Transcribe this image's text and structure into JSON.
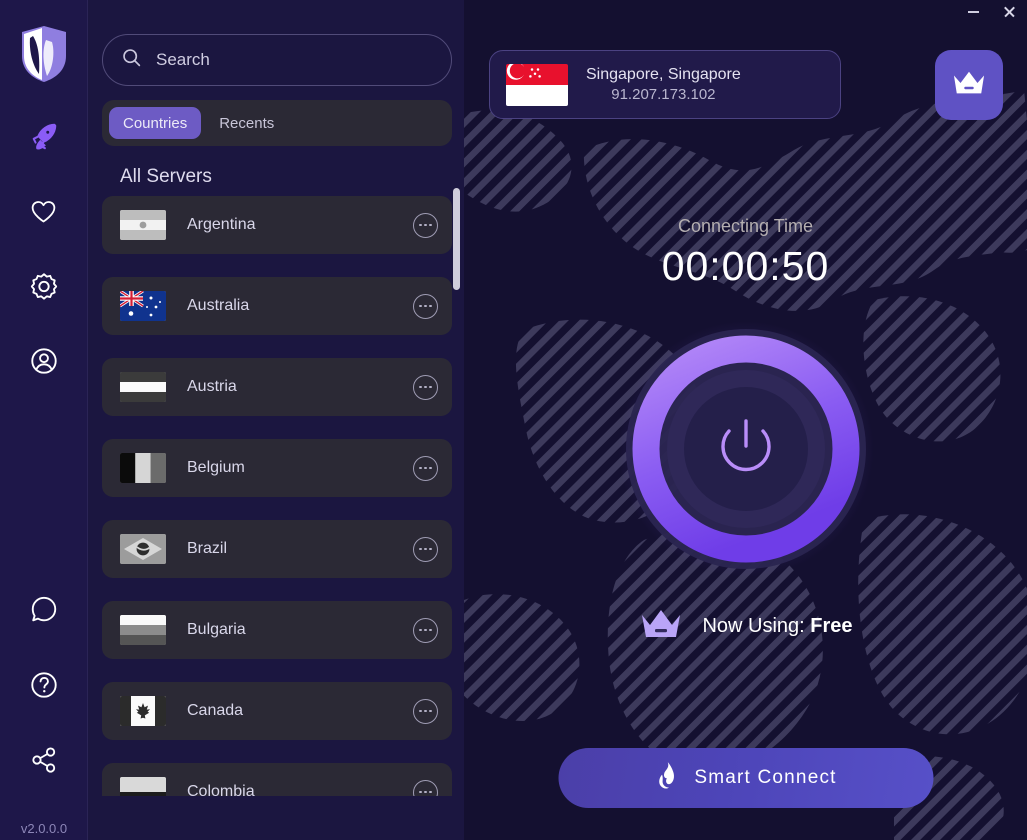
{
  "window": {
    "minimize_label": "Minimize",
    "close_label": "Close"
  },
  "sidebar": {
    "logo_name": "shield-logo",
    "version": "v2.0.0.0",
    "top_items": [
      {
        "name": "rocket",
        "label": "Connect",
        "active": true
      },
      {
        "name": "heart",
        "label": "Favorites",
        "active": false
      },
      {
        "name": "gear",
        "label": "Settings",
        "active": false
      },
      {
        "name": "user",
        "label": "Account",
        "active": false
      }
    ],
    "bottom_items": [
      {
        "name": "chat",
        "label": "Chat Support"
      },
      {
        "name": "help",
        "label": "Help"
      },
      {
        "name": "share",
        "label": "Share"
      }
    ]
  },
  "search": {
    "value": "",
    "placeholder": "Search",
    "icon": "search-icon"
  },
  "tabs": [
    {
      "label": "Countries",
      "active": true
    },
    {
      "label": "Recents",
      "active": false
    }
  ],
  "server_list": {
    "title": "All Servers",
    "more_icon": "ellipsis-icon",
    "countries": [
      {
        "name": "Argentina",
        "flag": "ar"
      },
      {
        "name": "Australia",
        "flag": "au"
      },
      {
        "name": "Austria",
        "flag": "at"
      },
      {
        "name": "Belgium",
        "flag": "be"
      },
      {
        "name": "Brazil",
        "flag": "br"
      },
      {
        "name": "Bulgaria",
        "flag": "bg"
      },
      {
        "name": "Canada",
        "flag": "ca"
      },
      {
        "name": "Colombia",
        "flag": "co"
      }
    ]
  },
  "connection": {
    "location": "Singapore, Singapore",
    "ip": "91.207.173.102",
    "flag": "sg",
    "premium_icon": "crown-icon",
    "timer_label": "Connecting Time",
    "timer_value": "00:00:50",
    "power_icon": "power-icon",
    "plan_icon": "crown-icon",
    "plan_label": "Now Using:",
    "plan_value": "Free"
  },
  "smart_connect": {
    "label": "Smart Connect",
    "icon": "flame-icon"
  },
  "colors": {
    "accent_purple": "#8b5cf6",
    "ring_bright": "#9b6ff5",
    "panel_bg": "#1b1640",
    "rail_bg": "#1e1749",
    "map_bg": "#141030",
    "row_bg": "#2b2935",
    "button_gradient_start": "#4b3fa8",
    "button_gradient_end": "#5750c8"
  }
}
